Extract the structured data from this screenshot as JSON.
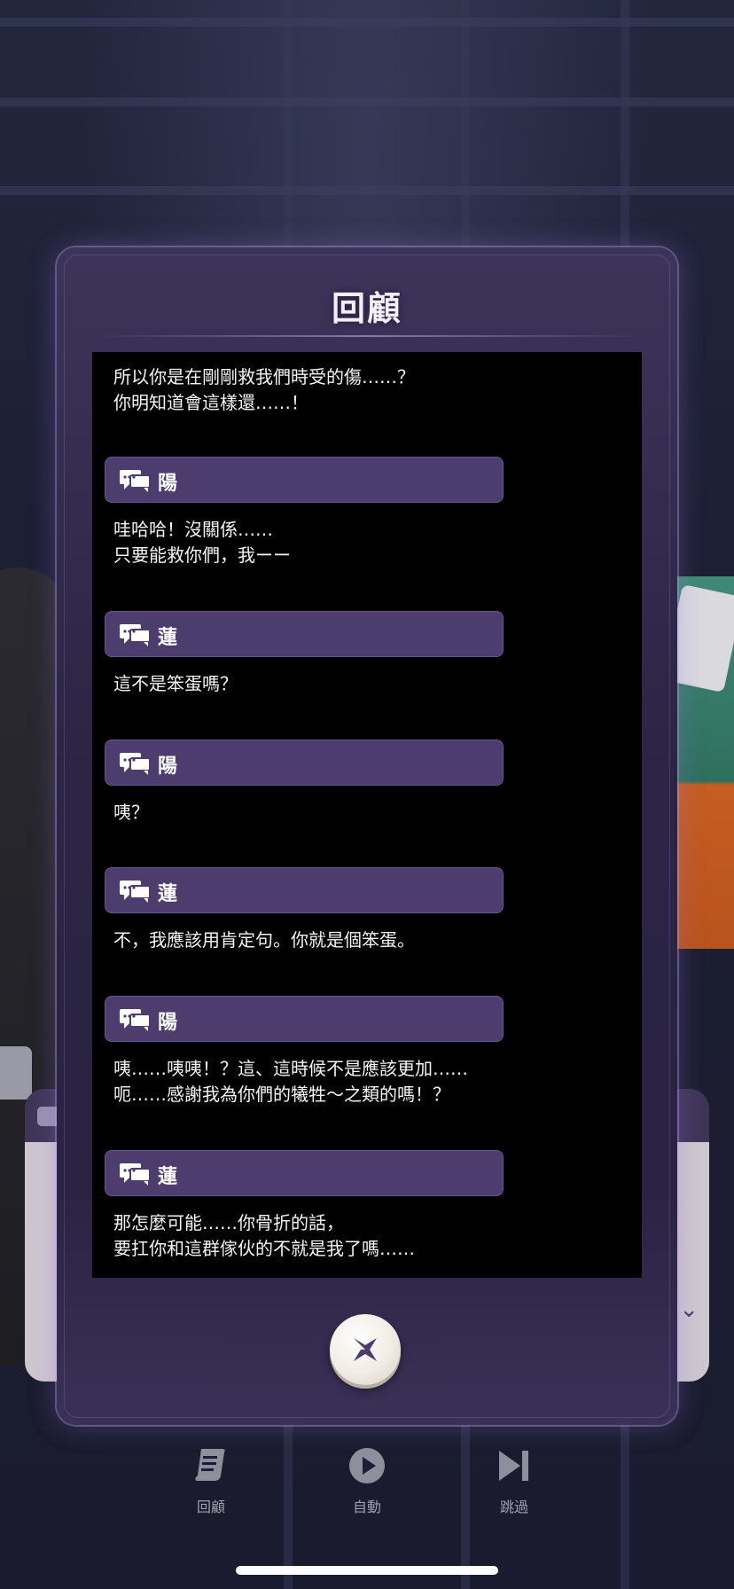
{
  "dialog": {
    "title": "回顧",
    "entries": [
      {
        "text": "所以你是在剛剛救我們時受的傷……？\n你明知道會這樣還……！"
      },
      {
        "speaker": "陽",
        "text": "哇哈哈！沒關係……\n只要能救你們，我ーー"
      },
      {
        "speaker": "蓮",
        "text": "這不是笨蛋嗎？"
      },
      {
        "speaker": "陽",
        "text": "咦？"
      },
      {
        "speaker": "蓮",
        "text": "不，我應該用肯定句。你就是個笨蛋。"
      },
      {
        "speaker": "陽",
        "text": "咦……咦咦！？這、這時候不是應該更加……\n呃……感謝我為你們的犧牲～之類的嗎！？"
      },
      {
        "speaker": "蓮",
        "text": "那怎麼可能……你骨折的話，\n要扛你和這群傢伙的不就是我了嗎……"
      }
    ]
  },
  "toolbar": {
    "items": [
      {
        "label": "回顧",
        "icon": "scroll-log-icon"
      },
      {
        "label": "自動",
        "icon": "play-icon"
      },
      {
        "label": "跳過",
        "icon": "skip-icon"
      }
    ]
  },
  "colors": {
    "speaker_bar": "#4d3d6e",
    "dialog_bg": "#2b2444",
    "log_bg": "#000000",
    "toolbar_label": "#9fa0ad"
  }
}
